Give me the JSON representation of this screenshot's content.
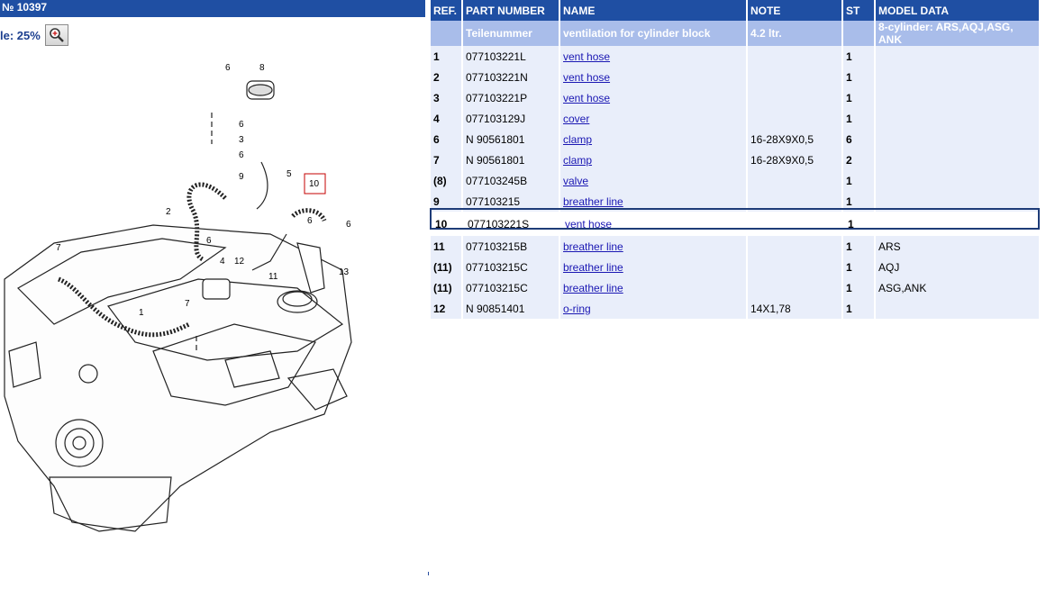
{
  "header": {
    "title": "№ 10397"
  },
  "scale": {
    "label": "le: 25%",
    "zoom_icon": "magnifier-plus-icon"
  },
  "columns": [
    "REF.",
    "PART NUMBER",
    "NAME",
    "NOTE",
    "ST",
    "MODEL DATA"
  ],
  "subheader": {
    "ref": "",
    "part": "Teilenummer",
    "name": "ventilation for cylinder block",
    "note": "4.2 ltr.",
    "st": "",
    "model": "8-cylinder: ARS,AQJ,ASG, ANK"
  },
  "rows": [
    {
      "ref": "1",
      "part": "077103221L",
      "name": "vent hose",
      "note": "",
      "st": "1",
      "model": ""
    },
    {
      "ref": "2",
      "part": "077103221N",
      "name": "vent hose",
      "note": "",
      "st": "1",
      "model": ""
    },
    {
      "ref": "3",
      "part": "077103221P",
      "name": "vent hose",
      "note": "",
      "st": "1",
      "model": ""
    },
    {
      "ref": "4",
      "part": "077103129J",
      "name": "cover",
      "note": "",
      "st": "1",
      "model": ""
    },
    {
      "ref": "6",
      "part": "N 90561801",
      "name": "clamp",
      "note": "16-28X9X0,5",
      "st": "6",
      "model": ""
    },
    {
      "ref": "7",
      "part": "N 90561801",
      "name": "clamp",
      "note": "16-28X9X0,5",
      "st": "2",
      "model": ""
    },
    {
      "ref": "(8)",
      "part": "077103245B",
      "name": "valve",
      "note": "",
      "st": "1",
      "model": ""
    },
    {
      "ref": "9",
      "part": "077103215",
      "name": "breather line",
      "note": "",
      "st": "1",
      "model": ""
    },
    {
      "ref": "10",
      "part": "077103221S",
      "name": "vent hose",
      "note": "",
      "st": "1",
      "model": ""
    },
    {
      "ref": "11",
      "part": "077103215B",
      "name": "breather line",
      "note": "",
      "st": "1",
      "model": "ARS"
    },
    {
      "ref": "(11)",
      "part": "077103215C",
      "name": "breather line",
      "note": "",
      "st": "1",
      "model": "AQJ"
    },
    {
      "ref": "(11)",
      "part": "077103215C",
      "name": "breather line",
      "note": "",
      "st": "1",
      "model": "ASG,ANK"
    },
    {
      "ref": "12",
      "part": "N 90851401",
      "name": "o-ring",
      "note": "14X1,78",
      "st": "1",
      "model": ""
    }
  ],
  "selected_ref": "10",
  "diagram": {
    "callouts": [
      "6",
      "8",
      "6",
      "3",
      "6",
      "9",
      "5",
      "10",
      "2",
      "6",
      "6",
      "7",
      "4",
      "12",
      "11",
      "13",
      "7",
      "1"
    ]
  },
  "colors": {
    "header_blue": "#1f4fa3",
    "sub_blue": "#a9bdea",
    "row_bg": "#e9eefa",
    "link": "#1a17b3"
  }
}
